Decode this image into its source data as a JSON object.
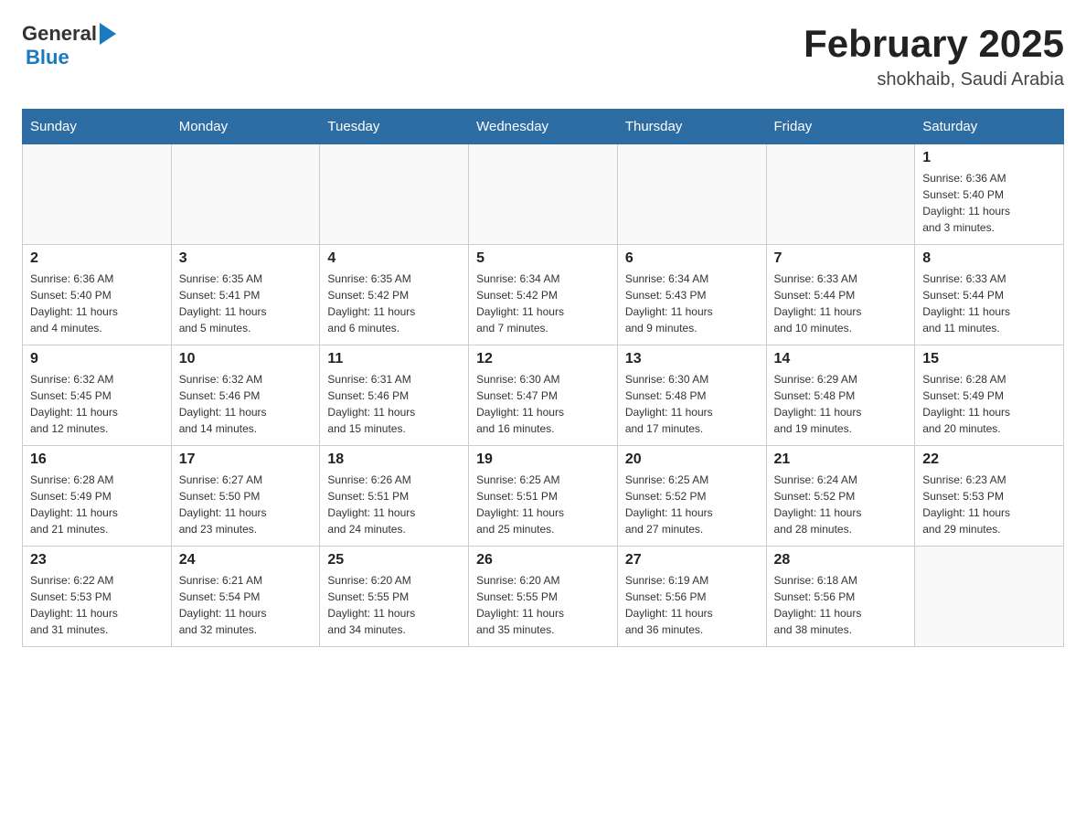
{
  "header": {
    "logo_general": "General",
    "logo_blue": "Blue",
    "month_title": "February 2025",
    "location": "shokhaib, Saudi Arabia"
  },
  "weekdays": [
    "Sunday",
    "Monday",
    "Tuesday",
    "Wednesday",
    "Thursday",
    "Friday",
    "Saturday"
  ],
  "weeks": [
    [
      {
        "day": "",
        "info": ""
      },
      {
        "day": "",
        "info": ""
      },
      {
        "day": "",
        "info": ""
      },
      {
        "day": "",
        "info": ""
      },
      {
        "day": "",
        "info": ""
      },
      {
        "day": "",
        "info": ""
      },
      {
        "day": "1",
        "info": "Sunrise: 6:36 AM\nSunset: 5:40 PM\nDaylight: 11 hours\nand 3 minutes."
      }
    ],
    [
      {
        "day": "2",
        "info": "Sunrise: 6:36 AM\nSunset: 5:40 PM\nDaylight: 11 hours\nand 4 minutes."
      },
      {
        "day": "3",
        "info": "Sunrise: 6:35 AM\nSunset: 5:41 PM\nDaylight: 11 hours\nand 5 minutes."
      },
      {
        "day": "4",
        "info": "Sunrise: 6:35 AM\nSunset: 5:42 PM\nDaylight: 11 hours\nand 6 minutes."
      },
      {
        "day": "5",
        "info": "Sunrise: 6:34 AM\nSunset: 5:42 PM\nDaylight: 11 hours\nand 7 minutes."
      },
      {
        "day": "6",
        "info": "Sunrise: 6:34 AM\nSunset: 5:43 PM\nDaylight: 11 hours\nand 9 minutes."
      },
      {
        "day": "7",
        "info": "Sunrise: 6:33 AM\nSunset: 5:44 PM\nDaylight: 11 hours\nand 10 minutes."
      },
      {
        "day": "8",
        "info": "Sunrise: 6:33 AM\nSunset: 5:44 PM\nDaylight: 11 hours\nand 11 minutes."
      }
    ],
    [
      {
        "day": "9",
        "info": "Sunrise: 6:32 AM\nSunset: 5:45 PM\nDaylight: 11 hours\nand 12 minutes."
      },
      {
        "day": "10",
        "info": "Sunrise: 6:32 AM\nSunset: 5:46 PM\nDaylight: 11 hours\nand 14 minutes."
      },
      {
        "day": "11",
        "info": "Sunrise: 6:31 AM\nSunset: 5:46 PM\nDaylight: 11 hours\nand 15 minutes."
      },
      {
        "day": "12",
        "info": "Sunrise: 6:30 AM\nSunset: 5:47 PM\nDaylight: 11 hours\nand 16 minutes."
      },
      {
        "day": "13",
        "info": "Sunrise: 6:30 AM\nSunset: 5:48 PM\nDaylight: 11 hours\nand 17 minutes."
      },
      {
        "day": "14",
        "info": "Sunrise: 6:29 AM\nSunset: 5:48 PM\nDaylight: 11 hours\nand 19 minutes."
      },
      {
        "day": "15",
        "info": "Sunrise: 6:28 AM\nSunset: 5:49 PM\nDaylight: 11 hours\nand 20 minutes."
      }
    ],
    [
      {
        "day": "16",
        "info": "Sunrise: 6:28 AM\nSunset: 5:49 PM\nDaylight: 11 hours\nand 21 minutes."
      },
      {
        "day": "17",
        "info": "Sunrise: 6:27 AM\nSunset: 5:50 PM\nDaylight: 11 hours\nand 23 minutes."
      },
      {
        "day": "18",
        "info": "Sunrise: 6:26 AM\nSunset: 5:51 PM\nDaylight: 11 hours\nand 24 minutes."
      },
      {
        "day": "19",
        "info": "Sunrise: 6:25 AM\nSunset: 5:51 PM\nDaylight: 11 hours\nand 25 minutes."
      },
      {
        "day": "20",
        "info": "Sunrise: 6:25 AM\nSunset: 5:52 PM\nDaylight: 11 hours\nand 27 minutes."
      },
      {
        "day": "21",
        "info": "Sunrise: 6:24 AM\nSunset: 5:52 PM\nDaylight: 11 hours\nand 28 minutes."
      },
      {
        "day": "22",
        "info": "Sunrise: 6:23 AM\nSunset: 5:53 PM\nDaylight: 11 hours\nand 29 minutes."
      }
    ],
    [
      {
        "day": "23",
        "info": "Sunrise: 6:22 AM\nSunset: 5:53 PM\nDaylight: 11 hours\nand 31 minutes."
      },
      {
        "day": "24",
        "info": "Sunrise: 6:21 AM\nSunset: 5:54 PM\nDaylight: 11 hours\nand 32 minutes."
      },
      {
        "day": "25",
        "info": "Sunrise: 6:20 AM\nSunset: 5:55 PM\nDaylight: 11 hours\nand 34 minutes."
      },
      {
        "day": "26",
        "info": "Sunrise: 6:20 AM\nSunset: 5:55 PM\nDaylight: 11 hours\nand 35 minutes."
      },
      {
        "day": "27",
        "info": "Sunrise: 6:19 AM\nSunset: 5:56 PM\nDaylight: 11 hours\nand 36 minutes."
      },
      {
        "day": "28",
        "info": "Sunrise: 6:18 AM\nSunset: 5:56 PM\nDaylight: 11 hours\nand 38 minutes."
      },
      {
        "day": "",
        "info": ""
      }
    ]
  ]
}
